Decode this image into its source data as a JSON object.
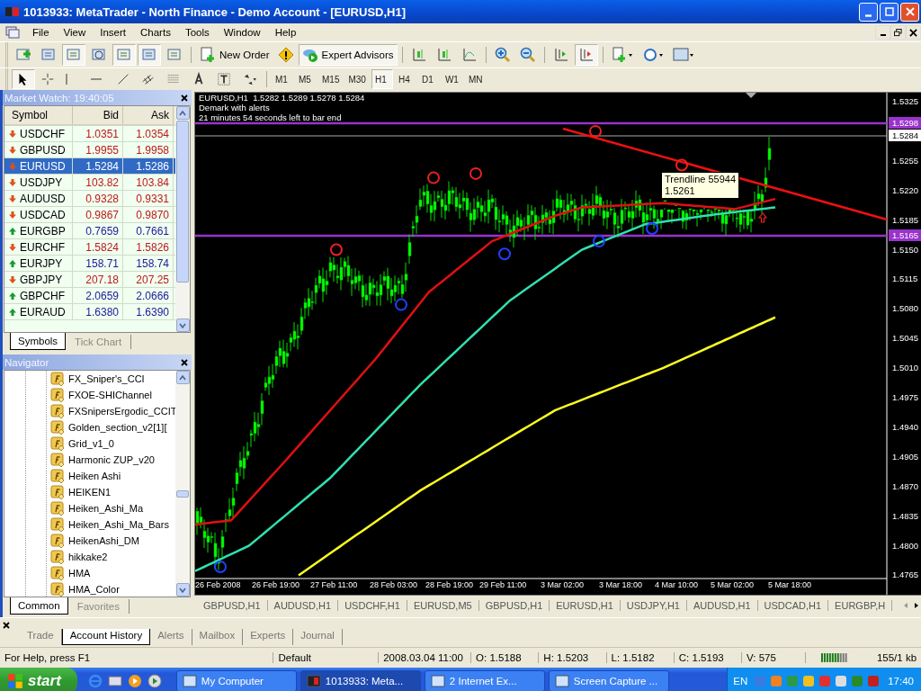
{
  "window": {
    "title": "1013933: MetaTrader - North Finance - Demo Account - [EURUSD,H1]"
  },
  "menu": [
    "File",
    "View",
    "Insert",
    "Charts",
    "Tools",
    "Window",
    "Help"
  ],
  "toolbar": {
    "new_order": "New Order",
    "expert_advisors": {
      "label": "Expert Advisors",
      "selected": true
    }
  },
  "timeframes": [
    {
      "label": "M1",
      "selected": false
    },
    {
      "label": "M5",
      "selected": false
    },
    {
      "label": "M15",
      "selected": false
    },
    {
      "label": "M30",
      "selected": false
    },
    {
      "label": "H1",
      "selected": true
    },
    {
      "label": "H4",
      "selected": false
    },
    {
      "label": "D1",
      "selected": false
    },
    {
      "label": "W1",
      "selected": false
    },
    {
      "label": "MN",
      "selected": false
    }
  ],
  "market_watch": {
    "title": "Market Watch: 19:40:05",
    "columns": [
      "Symbol",
      "Bid",
      "Ask"
    ],
    "rows": [
      {
        "symbol": "USDCHF",
        "bid": "1.0351",
        "ask": "1.0354",
        "kind": "down",
        "selected": false
      },
      {
        "symbol": "GBPUSD",
        "bid": "1.9955",
        "ask": "1.9958",
        "kind": "down",
        "selected": false
      },
      {
        "symbol": "EURUSD",
        "bid": "1.5284",
        "ask": "1.5286",
        "kind": "down",
        "selected": true
      },
      {
        "symbol": "USDJPY",
        "bid": "103.82",
        "ask": "103.84",
        "kind": "down",
        "selected": false
      },
      {
        "symbol": "AUDUSD",
        "bid": "0.9328",
        "ask": "0.9331",
        "kind": "down",
        "selected": false
      },
      {
        "symbol": "USDCAD",
        "bid": "0.9867",
        "ask": "0.9870",
        "kind": "down",
        "selected": false
      },
      {
        "symbol": "EURGBP",
        "bid": "0.7659",
        "ask": "0.7661",
        "kind": "up",
        "selected": false
      },
      {
        "symbol": "EURCHF",
        "bid": "1.5824",
        "ask": "1.5826",
        "kind": "down",
        "selected": false
      },
      {
        "symbol": "EURJPY",
        "bid": "158.71",
        "ask": "158.74",
        "kind": "up",
        "selected": false
      },
      {
        "symbol": "GBPJPY",
        "bid": "207.18",
        "ask": "207.25",
        "kind": "down",
        "selected": false
      },
      {
        "symbol": "GBPCHF",
        "bid": "2.0659",
        "ask": "2.0666",
        "kind": "up",
        "selected": false
      },
      {
        "symbol": "EURAUD",
        "bid": "1.6380",
        "ask": "1.6390",
        "kind": "up",
        "selected": false
      }
    ],
    "tabs": [
      {
        "label": "Symbols",
        "selected": true
      },
      {
        "label": "Tick Chart",
        "selected": false
      }
    ]
  },
  "navigator": {
    "title": "Navigator",
    "items": [
      "FX_Sniper's_CCI",
      "FXOE-SHIChannel",
      "FXSnipersErgodic_CCIT",
      "Golden_section_v2[1][",
      "Grid_v1_0",
      "Harmonic ZUP_v20",
      "Heiken Ashi",
      "HEIKEN1",
      "Heiken_Ashi_Ma",
      "Heiken_Ashi_Ma_Bars",
      "HeikenAshi_DM",
      "hikkake2",
      "HMA",
      "HMA_Color"
    ],
    "tabs": [
      {
        "label": "Common",
        "selected": true
      },
      {
        "label": "Favorites",
        "selected": false
      }
    ]
  },
  "chart": {
    "info": [
      "EURUSD,H1  1.5282 1.5289 1.5278 1.5284",
      "Demark with alerts",
      "21 minutes 54 seconds left to bar end"
    ],
    "tooltip": [
      "Trendline 55944",
      "1.5261"
    ],
    "price_ticks": [
      "1.5325",
      "1.5255",
      "1.5220",
      "1.5185",
      "1.5150",
      "1.5115",
      "1.5080",
      "1.5045",
      "1.5010",
      "1.4975",
      "1.4940",
      "1.4905",
      "1.4870",
      "1.4835",
      "1.4800",
      "1.4765"
    ],
    "levels": [
      {
        "label": "1.5298",
        "color": "#9933cc"
      },
      {
        "label": "1.5165",
        "color": "#9933cc"
      }
    ],
    "bid_label": "1.5284",
    "time_ticks": [
      "26 Feb 2008",
      "26 Feb 19:00",
      "27 Feb 11:00",
      "28 Feb 03:00",
      "28 Feb 19:00",
      "29 Feb 11:00",
      "3 Mar 02:00",
      "3 Mar 18:00",
      "4 Mar 10:00",
      "5 Mar 02:00",
      "5 Mar 18:00"
    ]
  },
  "chart_tabs": [
    "GBPUSD,H1",
    "AUDUSD,H1",
    "USDCHF,H1",
    "EURUSD,M5",
    "GBPUSD,H1",
    "EURUSD,H1",
    "USDJPY,H1",
    "AUDUSD,H1",
    "USDCAD,H1",
    "EURGBP,H"
  ],
  "terminal_tabs": [
    {
      "label": "Trade",
      "selected": false
    },
    {
      "label": "Account History",
      "selected": true
    },
    {
      "label": "Alerts",
      "selected": false
    },
    {
      "label": "Mailbox",
      "selected": false
    },
    {
      "label": "Experts",
      "selected": false
    },
    {
      "label": "Journal",
      "selected": false
    }
  ],
  "status_bar": [
    "For Help, press F1",
    "Default",
    "2008.03.04 11:00",
    "O: 1.5188",
    "H: 1.5203",
    "L: 1.5182",
    "C: 1.5193",
    "V: 575",
    "155/1 kb"
  ],
  "taskbar": {
    "start": "start",
    "tasks": [
      {
        "label": "My Computer",
        "selected": false
      },
      {
        "label": "1013933: Meta...",
        "selected": true
      },
      {
        "label": "2 Internet Ex...",
        "selected": false
      },
      {
        "label": "Screen Capture ...",
        "selected": false
      }
    ],
    "language": "EN",
    "clock": "17:40"
  }
}
